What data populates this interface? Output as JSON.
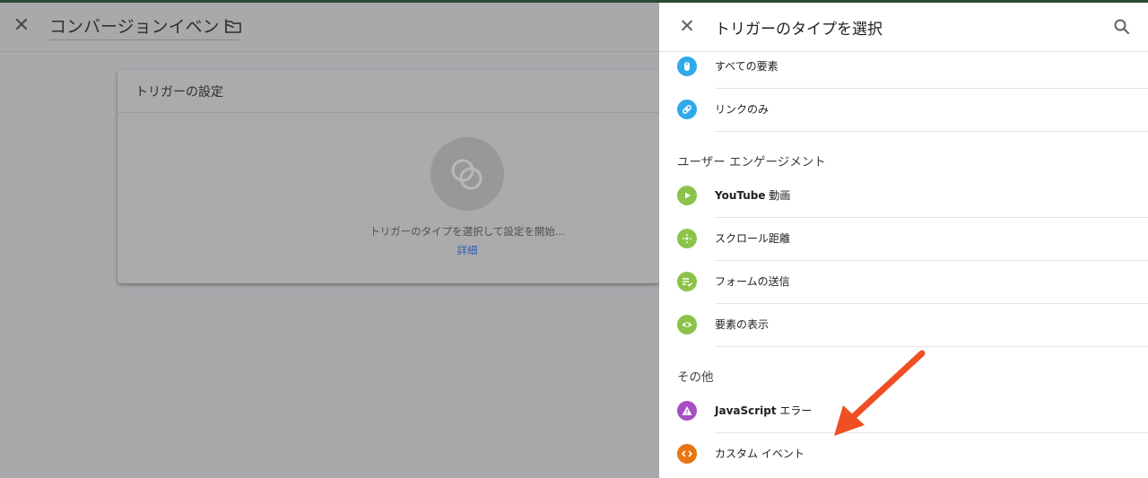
{
  "editor": {
    "title": "コンバージョンイベント",
    "card_title": "トリガーの設定",
    "hint": "トリガーのタイプを選択して設定を開始...",
    "link": "詳細"
  },
  "panel": {
    "title": "トリガーのタイプを選択",
    "items_click": [
      {
        "label": "すべての要素",
        "icon": "mouse-icon",
        "color": "#2fa9ea"
      },
      {
        "label": "リンクのみ",
        "icon": "link-icon",
        "color": "#2fa9ea"
      }
    ],
    "section_engagement": "ユーザー エンゲージメント",
    "items_engagement": [
      {
        "label_bold": "YouTube",
        "label": " 動画",
        "icon": "play-icon",
        "color": "#8bc34a"
      },
      {
        "label": "スクロール距離",
        "icon": "scroll-arrows-icon",
        "color": "#8bc34a"
      },
      {
        "label": "フォームの送信",
        "icon": "form-check-icon",
        "color": "#8bc34a"
      },
      {
        "label": "要素の表示",
        "icon": "eye-icon",
        "color": "#8bc34a"
      }
    ],
    "section_other": "その他",
    "items_other": [
      {
        "label_bold": "JavaScript",
        "label": " エラー",
        "icon": "warning-icon",
        "color": "#a64ec2"
      },
      {
        "label": "カスタム イベント",
        "icon": "code-icon",
        "color": "#ea7411"
      }
    ]
  },
  "annotation": {
    "arrow_color": "#f04e23"
  }
}
